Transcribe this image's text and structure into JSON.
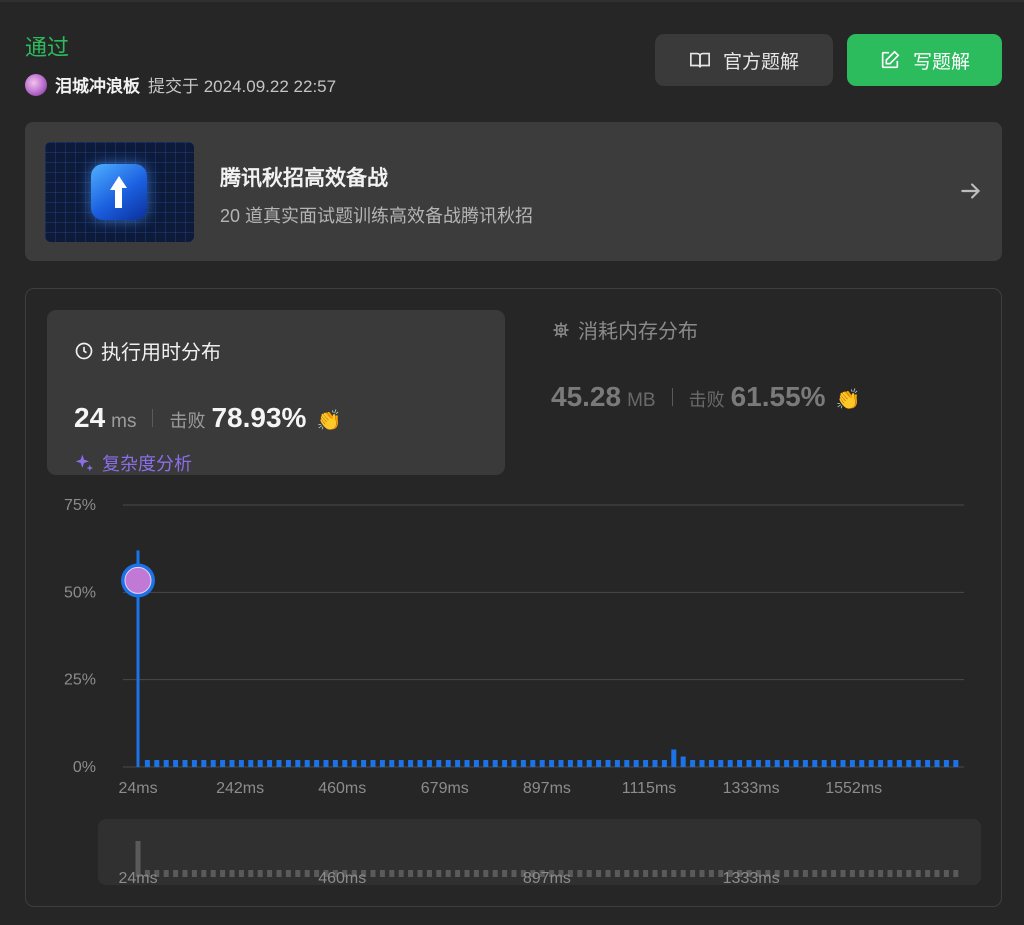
{
  "header": {
    "status": "通过",
    "username": "泪城冲浪板",
    "submitted_text": "提交于 2024.09.22 22:57",
    "official_solution_label": "官方题解",
    "write_solution_label": "写题解"
  },
  "promo": {
    "title": "腾讯秋招高效备战",
    "subtitle": "20 道真实面试题训练高效备战腾讯秋招"
  },
  "runtime": {
    "heading": "执行用时分布",
    "value": "24",
    "unit": "ms",
    "beat_label": "击败",
    "beat_percent": "78.93%",
    "complexity_label": "复杂度分析"
  },
  "memory": {
    "heading": "消耗内存分布",
    "value": "45.28",
    "unit": "MB",
    "beat_label": "击败",
    "beat_percent": "61.55%"
  },
  "colors": {
    "accent_green": "#2cbb5d",
    "bar_blue": "#1a73e8",
    "complexity_purple": "#8b6fe8"
  },
  "chart_data": {
    "type": "bar",
    "ylabel": "",
    "xlabel": "",
    "y_ticks": [
      "75%",
      "50%",
      "25%",
      "0%"
    ],
    "ylim": [
      0,
      75
    ],
    "x_ticks": [
      "24ms",
      "242ms",
      "460ms",
      "679ms",
      "897ms",
      "1115ms",
      "1333ms",
      "1552ms"
    ],
    "x_range_ms": [
      24,
      1770
    ],
    "highlight": {
      "x": 24,
      "y": 62
    },
    "values": [
      62,
      2,
      2,
      2,
      2,
      2,
      2,
      2,
      2,
      2,
      2,
      2,
      2,
      2,
      2,
      2,
      2,
      2,
      2,
      2,
      2,
      2,
      2,
      2,
      2,
      2,
      2,
      2,
      2,
      2,
      2,
      2,
      2,
      2,
      2,
      2,
      2,
      2,
      2,
      2,
      2,
      2,
      2,
      2,
      2,
      2,
      2,
      2,
      2,
      2,
      2,
      2,
      2,
      2,
      2,
      2,
      2,
      5,
      3,
      2,
      2,
      2,
      2,
      2,
      2,
      2,
      2,
      2,
      2,
      2,
      2,
      2,
      2,
      2,
      2,
      2,
      2,
      2,
      2,
      2,
      2,
      2,
      2,
      2,
      2,
      2,
      2,
      2
    ],
    "grid": true,
    "scroller_ticks": [
      "24ms",
      "460ms",
      "897ms",
      "1333ms"
    ]
  }
}
